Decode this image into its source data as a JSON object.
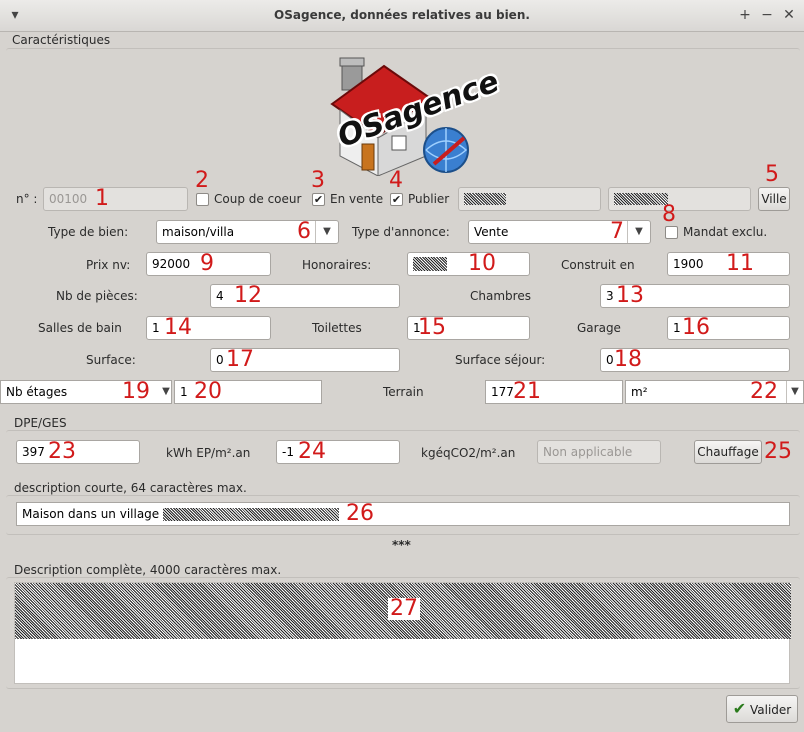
{
  "window": {
    "title": "OSagence, données relatives au bien.",
    "menu_glyph": "▾",
    "plus_glyph": "+",
    "min_glyph": "−",
    "close_glyph": "✕"
  },
  "logo": {
    "text": "OSagence"
  },
  "caracteristiques": {
    "title": "Caractéristiques"
  },
  "row1": {
    "n_label": "n° :",
    "n_value": "00100",
    "coup_coeur": {
      "label": "Coup de coeur",
      "checked": false
    },
    "en_vente": {
      "label": "En vente",
      "checked": true
    },
    "publier": {
      "label": "Publier",
      "checked": true
    },
    "ville_button": "Ville"
  },
  "row2": {
    "type_bien_label": "Type de bien:",
    "type_bien_value": "maison/villa",
    "type_annonce_label": "Type d'annonce:",
    "type_annonce_value": "Vente",
    "mandat_label": "Mandat exclu."
  },
  "row3": {
    "prix_label": "Prix nv:",
    "prix_value": "92000",
    "honoraires_label": "Honoraires:",
    "construit_label": "Construit en",
    "construit_value": "1900"
  },
  "row4": {
    "pieces_label": "Nb de pièces:",
    "pieces_value": "4",
    "chambres_label": "Chambres",
    "chambres_value": "3"
  },
  "row5": {
    "sdb_label": "Salles de bain",
    "sdb_value": "1",
    "toilettes_label": "Toilettes",
    "toilettes_value": "1",
    "garage_label": "Garage",
    "garage_value": "1"
  },
  "row6": {
    "surface_label": "Surface:",
    "surface_value": "0",
    "sejour_label": "Surface séjour:",
    "sejour_value": "0"
  },
  "row7": {
    "etages_value": "Nb étages",
    "etages_input": "1",
    "terrain_label": "Terrain",
    "terrain_value": "177",
    "unit_value": "m²"
  },
  "dpe": {
    "title": "DPE/GES",
    "dpe_value": "397",
    "kwh_label": "kWh EP/m².an",
    "ges_value": "-1",
    "kg_label": "kgéqCO2/m².an",
    "na_value": "Non applicable",
    "chauffage_button": "Chauffage"
  },
  "desc_courte": {
    "title": "description courte, 64 caractères max.",
    "value": "Maison dans un village"
  },
  "separator": "***",
  "desc_complete": {
    "title": "Description complète, 4000 caractères max."
  },
  "footer": {
    "valider_button": "Valider"
  },
  "annotations": [
    "1",
    "2",
    "3",
    "4",
    "5",
    "6",
    "7",
    "8",
    "9",
    "10",
    "11",
    "12",
    "13",
    "14",
    "15",
    "16",
    "17",
    "18",
    "19",
    "20",
    "21",
    "22",
    "23",
    "24",
    "25",
    "26",
    "27"
  ],
  "colors": {
    "annotation": "#d11a1a",
    "background": "#d6d3cf",
    "check": "#2a7a1c"
  }
}
